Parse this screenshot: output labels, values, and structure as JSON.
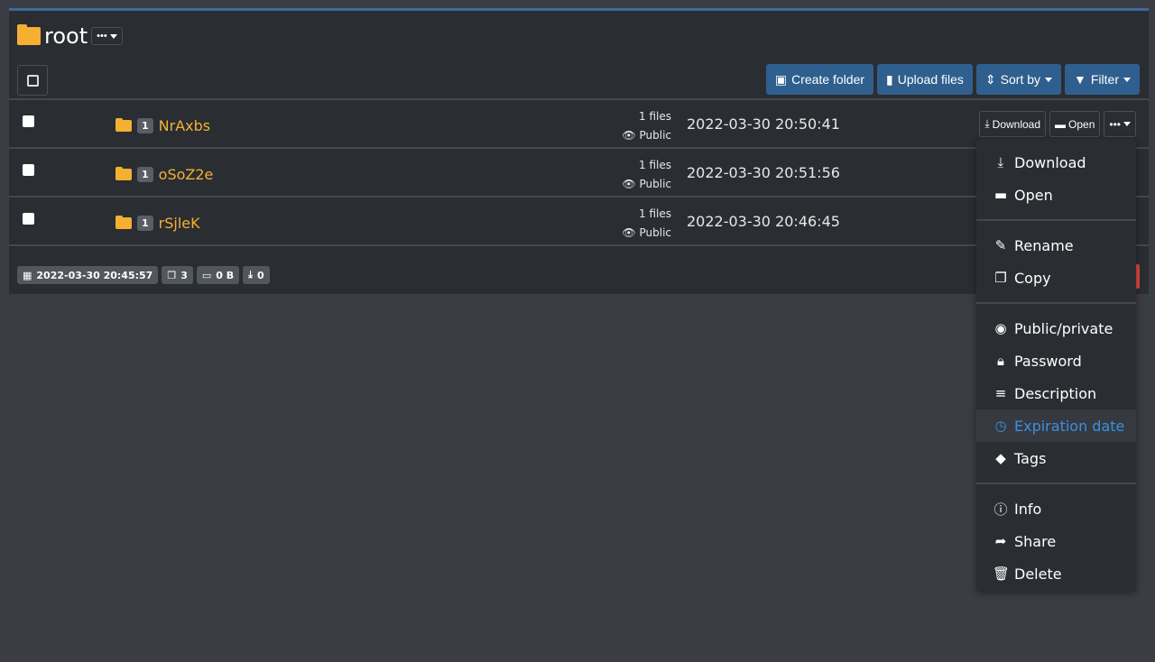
{
  "header": {
    "title": "root",
    "more_label": "•••"
  },
  "toolbar": {
    "create_folder": "Create folder",
    "upload_files": "Upload files",
    "sort_by": "Sort by",
    "filter": "Filter"
  },
  "rows": [
    {
      "name": "NrAxbs",
      "badge": "1",
      "files": "1 files",
      "visibility": "Public",
      "date": "2022-03-30 20:50:41"
    },
    {
      "name": "oSoZ2e",
      "badge": "1",
      "files": "1 files",
      "visibility": "Public",
      "date": "2022-03-30 20:51:56"
    },
    {
      "name": "rSjleK",
      "badge": "1",
      "files": "1 files",
      "visibility": "Public",
      "date": "2022-03-30 20:46:45"
    }
  ],
  "row_actions": {
    "download": "Download",
    "open": "Open",
    "more": "•••"
  },
  "footer": {
    "date": "2022-03-30 20:45:57",
    "files": "3",
    "size": "0 B",
    "downloads": "0"
  },
  "menu": {
    "items": [
      {
        "icon": "download-icon",
        "label": "Download"
      },
      {
        "icon": "folder-open-icon",
        "label": "Open"
      },
      {
        "icon": "edit-icon",
        "label": "Rename"
      },
      {
        "icon": "copy-icon",
        "label": "Copy"
      },
      {
        "icon": "eye-icon",
        "label": "Public/private"
      },
      {
        "icon": "lock-icon",
        "label": "Password"
      },
      {
        "icon": "align-center-icon",
        "label": "Description"
      },
      {
        "icon": "clock-icon",
        "label": "Expiration date",
        "active": true
      },
      {
        "icon": "tag-icon",
        "label": "Tags"
      },
      {
        "icon": "info-icon",
        "label": "Info"
      },
      {
        "icon": "share-icon",
        "label": "Share"
      },
      {
        "icon": "trash-icon",
        "label": "Delete"
      }
    ]
  },
  "colors": {
    "accent": "#2f5f8e",
    "folder": "#f5b031",
    "active": "#3b8fe0",
    "danger": "#d9453f"
  }
}
